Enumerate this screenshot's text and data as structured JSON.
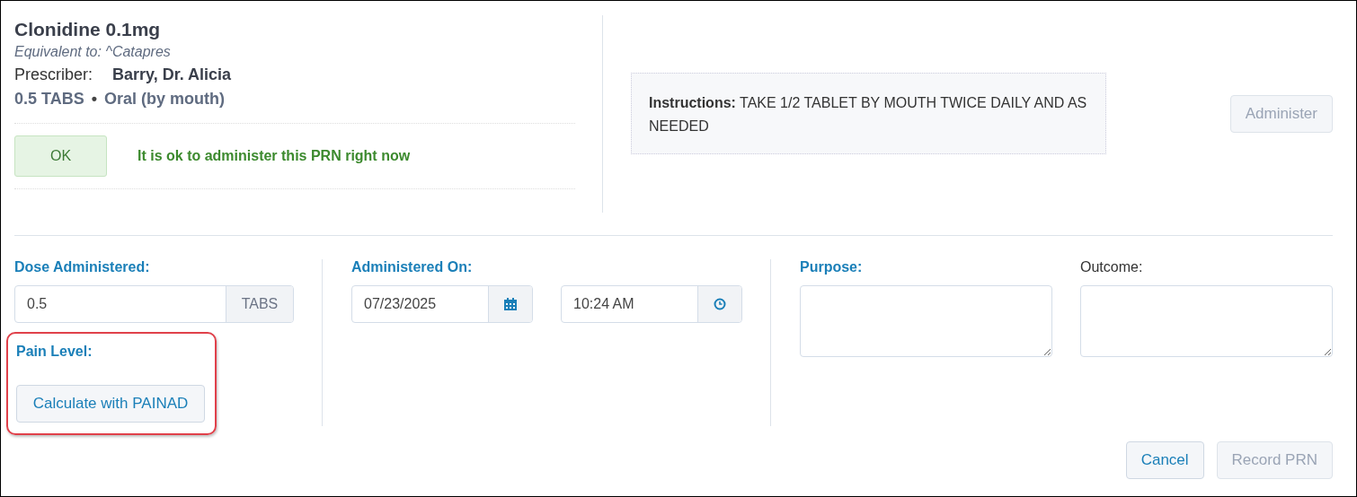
{
  "medication": {
    "name": "Clonidine 0.1mg",
    "equivalent": "Equivalent to: ^Catapres",
    "prescriber_label": "Prescriber:",
    "prescriber": "Barry, Dr. Alicia",
    "dose": "0.5 TABS",
    "separator": "•",
    "route": "Oral (by mouth)"
  },
  "status": {
    "badge": "OK",
    "message": "It is ok to administer this PRN right now"
  },
  "instructions": {
    "label": "Instructions:",
    "text": "TAKE 1/2 TABLET BY MOUTH TWICE DAILY AND AS NEEDED"
  },
  "administer_button": {
    "label": "Administer",
    "disabled": true
  },
  "dose": {
    "label": "Dose Administered:",
    "required": true,
    "value": "0.5",
    "unit": "TABS"
  },
  "pain": {
    "label": "Pain Level:",
    "required": true,
    "button": "Calculate with PAINAD",
    "highlighted": true
  },
  "administered_on": {
    "label": "Administered On:",
    "required": true,
    "date": "07/23/2025",
    "time": "10:24 AM"
  },
  "purpose": {
    "label": "Purpose:",
    "required": true
  },
  "outcome": {
    "label": "Outcome:",
    "required": false
  },
  "buttons": [
    {
      "label": "Cancel",
      "disabled": false
    },
    {
      "label": "Record PRN",
      "disabled": true
    }
  ]
}
